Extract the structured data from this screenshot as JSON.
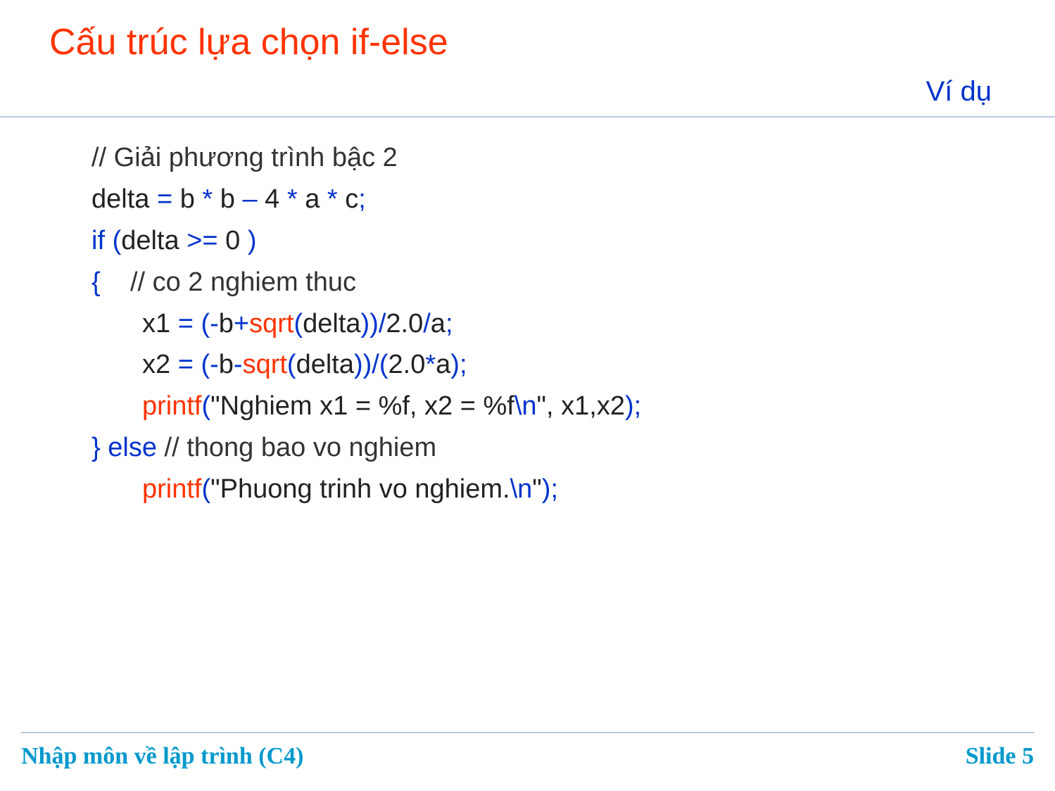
{
  "title": "Cấu trúc lựa chọn if-else",
  "subtitle": "Ví dụ",
  "code": {
    "l1_comment": "// Giải phương trình bậc 2",
    "l2": {
      "p1": "delta ",
      "eq": "=",
      "p2": " b ",
      "mul1": "*",
      "p3": " b ",
      "minus": "–",
      "p4": " 4 ",
      "mul2": "*",
      "p5": " a ",
      "mul3": "*",
      "p6": " c",
      "semi": ";"
    },
    "l3": {
      "kw": "if ",
      "lp": "(",
      "expr": "delta ",
      "op": ">=",
      "zero": " 0 ",
      "rp": ")"
    },
    "l4": {
      "brace": "{",
      "pad": "    ",
      "comment": "// co 2 nghiem thuc"
    },
    "l5": {
      "lhs": "x1 ",
      "eq": "= ",
      "lp": "(",
      "neg": "-",
      "b": "b",
      "plus": "+",
      "sqrt": "sqrt",
      "lp2": "(",
      "arg": "delta",
      "rp2": ")",
      "rp": ")",
      "div1": "/",
      "two": "2.0",
      "div2": "/",
      "a": "a",
      "semi": ";"
    },
    "l6": {
      "lhs": "x2 ",
      "eq": "= ",
      "lp": "(",
      "neg": "-",
      "b": "b",
      "minus": "-",
      "sqrt": "sqrt",
      "lp2": "(",
      "arg": "delta",
      "rp2": ")",
      "rp": ")",
      "div": "/",
      "lp3": "(",
      "two": "2.0",
      "mul": "*",
      "a": "a",
      "rp3": ")",
      "semi": ";"
    },
    "l7": {
      "fn": "printf",
      "lp": "(",
      "q1": "\"",
      "s1": "Nghiem x1 = %f, x2 = %f",
      "esc": "\\n",
      "q2": "\"",
      "args": ", x1,x2",
      "rp": ")",
      "semi": ";"
    },
    "l8": {
      "rbrace": "} ",
      "kw": "else ",
      "comment": "// thong bao vo nghiem"
    },
    "l9": {
      "fn": "printf",
      "lp": "(",
      "q1": "\"",
      "s1": "Phuong trinh vo nghiem.",
      "esc": "\\n",
      "q2": "\"",
      "rp": ")",
      "semi": ";"
    }
  },
  "footer": {
    "left": "Nhập môn về lập trình (C4)",
    "right": "Slide 5"
  }
}
